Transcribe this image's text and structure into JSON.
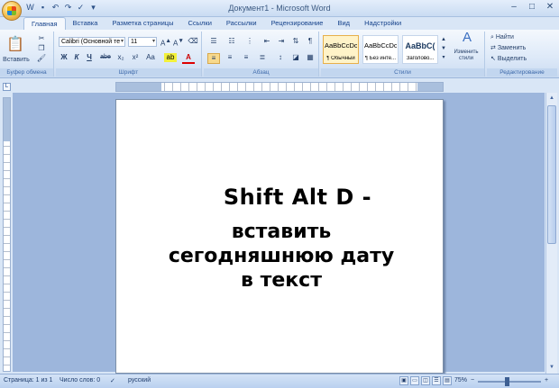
{
  "window": {
    "title": "Документ1 - Microsoft Word",
    "controls": [
      "–",
      "□",
      "✕"
    ]
  },
  "qat": {
    "icons": [
      "word-icon",
      "save-icon",
      "undo-icon",
      "redo-icon",
      "spell-icon",
      "more-icon"
    ]
  },
  "tabs": [
    {
      "label": "Главная",
      "active": true
    },
    {
      "label": "Вставка"
    },
    {
      "label": "Разметка страницы"
    },
    {
      "label": "Ссылки"
    },
    {
      "label": "Рассылки"
    },
    {
      "label": "Рецензирование"
    },
    {
      "label": "Вид"
    },
    {
      "label": "Надстройки"
    }
  ],
  "ribbon": {
    "clipboard": {
      "paste_label": "Вставить",
      "group_label": "Буфер обмена"
    },
    "font": {
      "font_name": "Calibri (Основной те",
      "font_size": "11",
      "group_label": "Шрифт",
      "bold": "Ж",
      "italic": "К",
      "underline": "Ч",
      "strike": "abe",
      "sub": "x₂",
      "sup": "x²",
      "case": "Aa"
    },
    "paragraph": {
      "group_label": "Абзац"
    },
    "styles": {
      "group_label": "Стили",
      "items": [
        {
          "sample": "AaBbCcDc",
          "name": "¶ Обычный",
          "selected": true
        },
        {
          "sample": "AaBbCcDc",
          "name": "¶ Без инте..."
        },
        {
          "sample": "AaBbC(",
          "name": "Заголово..."
        }
      ],
      "change_label": "Изменить стили"
    },
    "editing": {
      "group_label": "Редактирование",
      "find": "Найти",
      "replace": "Заменить",
      "select": "Выделить"
    }
  },
  "document": {
    "line1": "Shift Alt D -",
    "line2": "вставить",
    "line3": "сегодняшнюю дату",
    "line4": "в текст"
  },
  "status": {
    "page": "Страница: 1 из 1",
    "words": "Число слов: 0",
    "language": "русский",
    "zoom": "75%"
  }
}
